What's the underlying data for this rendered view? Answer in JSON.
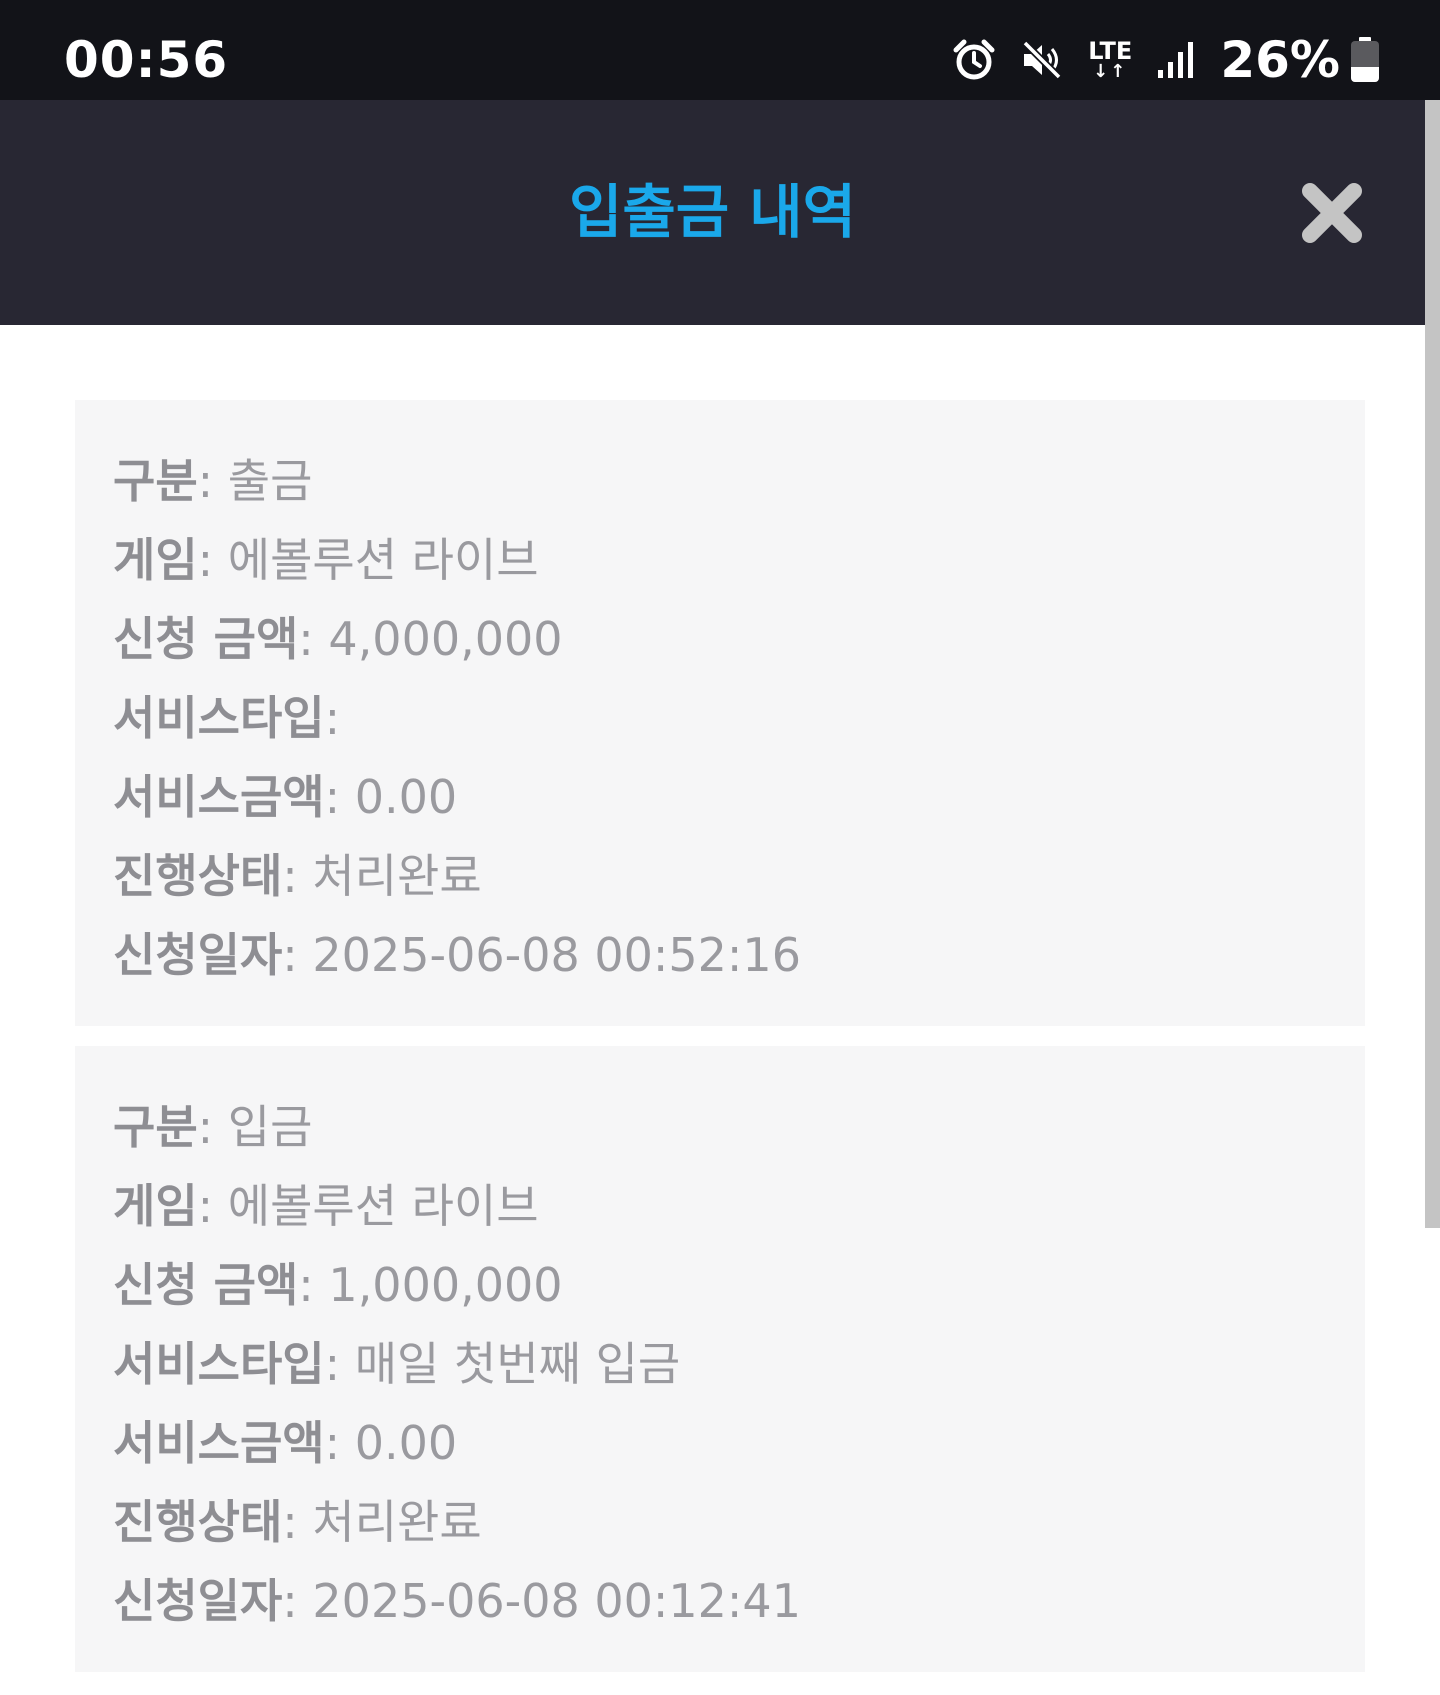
{
  "status_bar": {
    "time": "00:56",
    "network": "LTE",
    "battery": "26%",
    "icons": [
      "alarm-icon",
      "mute-icon",
      "lte-icon",
      "signal-icon",
      "battery-icon"
    ]
  },
  "header": {
    "title": "입출금 내역",
    "title_color": "#1aa8ea",
    "close_icon": "close-icon"
  },
  "labels": {
    "type": "구분",
    "game": "게임",
    "amount": "신청 금액",
    "service_type": "서비스타입",
    "service_amount": "서비스금액",
    "status": "진행상태",
    "date": "신청일자",
    "separator": ": "
  },
  "records": [
    {
      "type": "출금",
      "game": "에볼루션 라이브",
      "amount": "4,000,000",
      "service_type": "",
      "service_amount": "0.00",
      "status": "처리완료",
      "date": "2025-06-08 00:52:16"
    },
    {
      "type": "입금",
      "game": "에볼루션 라이브",
      "amount": "1,000,000",
      "service_type": "매일 첫번째 입금",
      "service_amount": "0.00",
      "status": "처리완료",
      "date": "2025-06-08 00:12:41"
    }
  ]
}
